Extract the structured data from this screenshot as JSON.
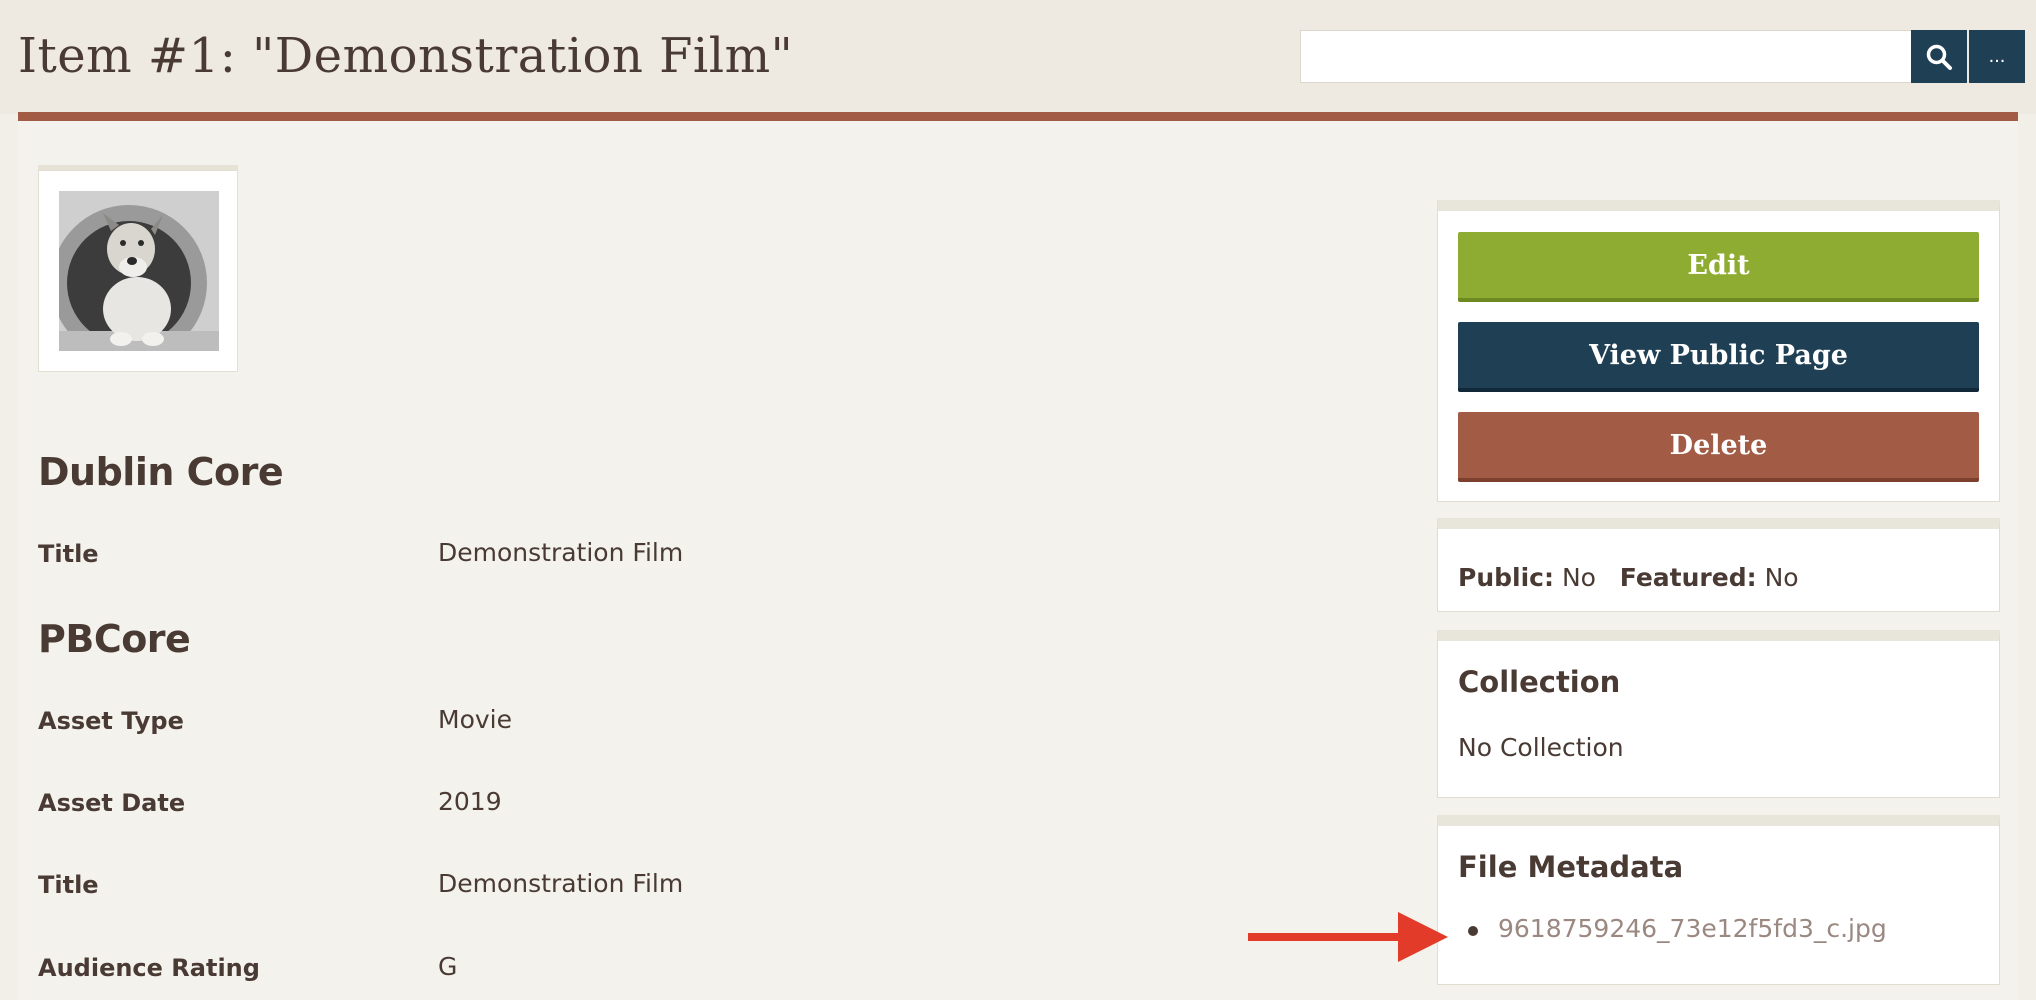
{
  "header": {
    "title": "Item #1: \"Demonstration Film\"",
    "search_value": "",
    "search_icon": "search-icon",
    "more_label": "..."
  },
  "item": {
    "thumbnail": "dog-photo-thumbnail",
    "sections": [
      {
        "heading": "Dublin Core",
        "fields": [
          {
            "label": "Title",
            "value": "Demonstration Film"
          }
        ]
      },
      {
        "heading": "PBCore",
        "fields": [
          {
            "label": "Asset Type",
            "value": "Movie"
          },
          {
            "label": "Asset Date",
            "value": "2019"
          },
          {
            "label": "Title",
            "value": "Demonstration Film"
          },
          {
            "label": "Audience Rating",
            "value": "G"
          }
        ]
      }
    ]
  },
  "sidebar": {
    "actions": {
      "edit_label": "Edit",
      "view_public_label": "View Public Page",
      "delete_label": "Delete"
    },
    "status": {
      "public_label": "Public:",
      "public_value": "No",
      "featured_label": "Featured:",
      "featured_value": "No"
    },
    "collection": {
      "heading": "Collection",
      "value": "No Collection"
    },
    "file_metadata": {
      "heading": "File Metadata",
      "files": [
        "9618759246_73e12f5fd3_c.jpg"
      ]
    }
  },
  "colors": {
    "accent_rule": "#a25b45",
    "edit_button": "#8fac32",
    "view_button": "#1f3f55",
    "delete_button": "#a25b45",
    "annotation_arrow": "#e23b2a"
  }
}
